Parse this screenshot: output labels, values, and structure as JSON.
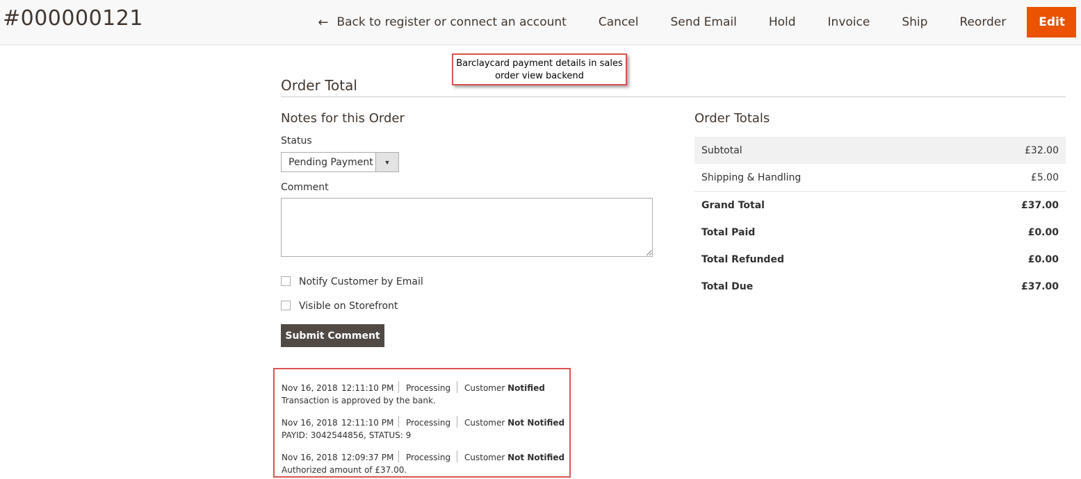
{
  "header": {
    "order_id": "#000000121",
    "back_label": "Back to register or connect an account",
    "actions": [
      "Cancel",
      "Send Email",
      "Hold",
      "Invoice",
      "Ship",
      "Reorder"
    ],
    "edit_label": "Edit",
    "accent_color": "#eb5202"
  },
  "callout": {
    "line1": "Barclaycard payment details in sales",
    "line2": "order view backend"
  },
  "section": {
    "title": "Order Total"
  },
  "notes": {
    "title": "Notes for this Order",
    "status_label": "Status",
    "status_value": "Pending Payment",
    "comment_label": "Comment",
    "comment_value": "",
    "notify_label": "Notify Customer by Email",
    "notify_checked": false,
    "visible_label": "Visible on Storefront",
    "visible_checked": false,
    "submit_label": "Submit Comment"
  },
  "history": [
    {
      "date": "Nov 16, 2018",
      "time": "12:11:10 PM",
      "status": "Processing",
      "customer": "Customer",
      "notified": "Notified",
      "comment": "Transaction is approved by the bank."
    },
    {
      "date": "Nov 16, 2018",
      "time": "12:11:10 PM",
      "status": "Processing",
      "customer": "Customer",
      "notified": "Not Notified",
      "comment": "PAYID: 3042544856, STATUS: 9"
    },
    {
      "date": "Nov 16, 2018",
      "time": "12:09:37 PM",
      "status": "Processing",
      "customer": "Customer",
      "notified": "Not Notified",
      "comment": "Authorized amount of £37.00."
    }
  ],
  "totals": {
    "title": "Order Totals",
    "rows": [
      {
        "label": "Subtotal",
        "amount": "£32.00"
      },
      {
        "label": "Shipping & Handling",
        "amount": "£5.00"
      },
      {
        "label": "Grand Total",
        "amount": "£37.00"
      },
      {
        "label": "Total Paid",
        "amount": "£0.00"
      },
      {
        "label": "Total Refunded",
        "amount": "£0.00"
      },
      {
        "label": "Total Due",
        "amount": "£37.00"
      }
    ]
  }
}
